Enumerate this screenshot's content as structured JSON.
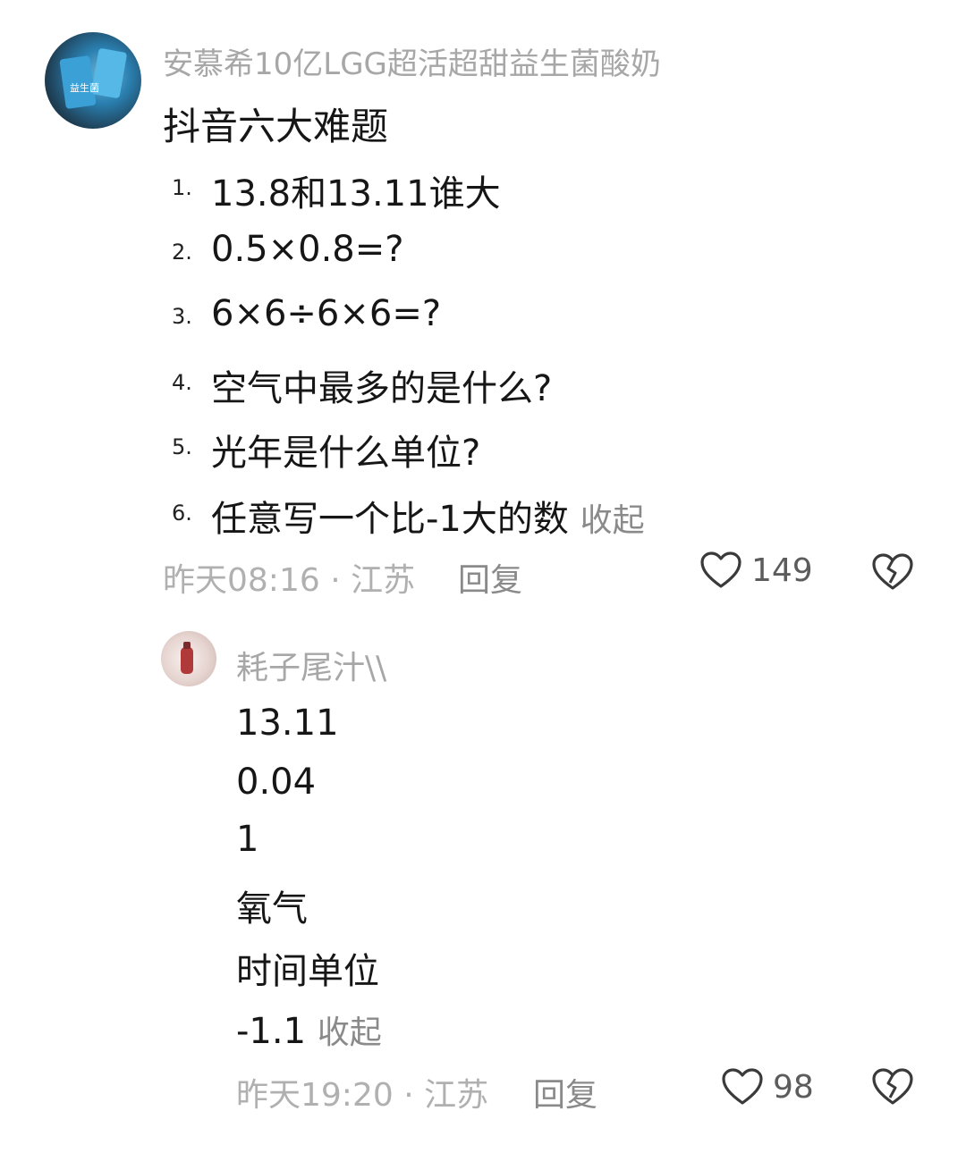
{
  "comment1": {
    "username": "安慕希10亿LGG超活超甜益生菌酸奶",
    "title": "抖音六大难题",
    "items": [
      {
        "num": "1.",
        "text": "13.8和13.11谁大"
      },
      {
        "num": "2.",
        "text": "0.5×0.8=?"
      },
      {
        "num": "3.",
        "text": "6×6÷6×6=?"
      },
      {
        "num": "4.",
        "text": "空气中最多的是什么?"
      },
      {
        "num": "5.",
        "text": "光年是什么单位?"
      },
      {
        "num": "6.",
        "text": "任意写一个比-1大的数"
      }
    ],
    "collapse_label": "收起",
    "meta": "昨天08:16 · 江苏",
    "reply_label": "回复",
    "like_count": "149",
    "avatar_text": "益生菌"
  },
  "comment2": {
    "username": "耗子尾汁\\\\",
    "answers": [
      "13.11",
      "0.04",
      "1",
      "氧气",
      "时间单位",
      "-1.1"
    ],
    "collapse_label": "收起",
    "meta": "昨天19:20 · 江苏",
    "reply_label": "回复",
    "like_count": "98"
  }
}
